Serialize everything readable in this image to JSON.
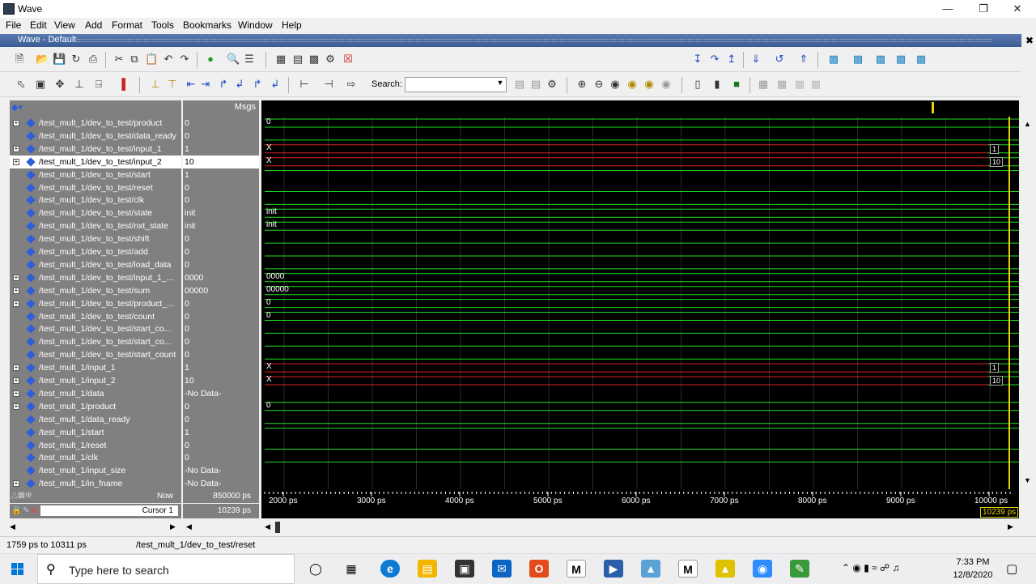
{
  "window": {
    "title": "Wave",
    "subwindow_title": "Wave - Default"
  },
  "menu": [
    "File",
    "Edit",
    "View",
    "Add",
    "Format",
    "Tools",
    "Bookmarks",
    "Window",
    "Help"
  ],
  "search": {
    "label": "Search:",
    "value": ""
  },
  "panes": {
    "msgs_header": "Msgs"
  },
  "signals": [
    {
      "name": "/test_mult_1/dev_to_test/product",
      "value": "0",
      "expandable": true
    },
    {
      "name": "/test_mult_1/dev_to_test/data_ready",
      "value": "0",
      "expandable": false
    },
    {
      "name": "/test_mult_1/dev_to_test/input_1",
      "value": "1",
      "expandable": true
    },
    {
      "name": "/test_mult_1/dev_to_test/input_2",
      "value": "10",
      "expandable": true,
      "selected": true
    },
    {
      "name": "/test_mult_1/dev_to_test/start",
      "value": "1",
      "expandable": false
    },
    {
      "name": "/test_mult_1/dev_to_test/reset",
      "value": "0",
      "expandable": false
    },
    {
      "name": "/test_mult_1/dev_to_test/clk",
      "value": "0",
      "expandable": false
    },
    {
      "name": "/test_mult_1/dev_to_test/state",
      "value": "init",
      "expandable": false
    },
    {
      "name": "/test_mult_1/dev_to_test/nxt_state",
      "value": "init",
      "expandable": false
    },
    {
      "name": "/test_mult_1/dev_to_test/shift",
      "value": "0",
      "expandable": false
    },
    {
      "name": "/test_mult_1/dev_to_test/add",
      "value": "0",
      "expandable": false
    },
    {
      "name": "/test_mult_1/dev_to_test/load_data",
      "value": "0",
      "expandable": false
    },
    {
      "name": "/test_mult_1/dev_to_test/input_1_...",
      "value": "0000",
      "expandable": true
    },
    {
      "name": "/test_mult_1/dev_to_test/sum",
      "value": "00000",
      "expandable": true
    },
    {
      "name": "/test_mult_1/dev_to_test/product_...",
      "value": "0",
      "expandable": true
    },
    {
      "name": "/test_mult_1/dev_to_test/count",
      "value": "0",
      "expandable": false
    },
    {
      "name": "/test_mult_1/dev_to_test/start_co...",
      "value": "0",
      "expandable": false
    },
    {
      "name": "/test_mult_1/dev_to_test/start_co...",
      "value": "0",
      "expandable": false
    },
    {
      "name": "/test_mult_1/dev_to_test/start_count",
      "value": "0",
      "expandable": false
    },
    {
      "name": "/test_mult_1/input_1",
      "value": "1",
      "expandable": true
    },
    {
      "name": "/test_mult_1/input_2",
      "value": "10",
      "expandable": true
    },
    {
      "name": "/test_mult_1/data",
      "value": "-No Data-",
      "expandable": true
    },
    {
      "name": "/test_mult_1/product",
      "value": "0",
      "expandable": true
    },
    {
      "name": "/test_mult_1/data_ready",
      "value": "0",
      "expandable": false
    },
    {
      "name": "/test_mult_1/start",
      "value": "1",
      "expandable": false
    },
    {
      "name": "/test_mult_1/reset",
      "value": "0",
      "expandable": false
    },
    {
      "name": "/test_mult_1/clk",
      "value": "0",
      "expandable": false
    },
    {
      "name": "/test_mult_1/input_size",
      "value": "-No Data-",
      "expandable": false
    },
    {
      "name": "/test_mult_1/in_fname",
      "value": "-No Data-",
      "expandable": true
    }
  ],
  "waves": [
    {
      "type": "bus",
      "color": "#22dd22",
      "start_text": "0"
    },
    {
      "type": "low",
      "color": "#22dd22"
    },
    {
      "type": "bus",
      "color": "#dd2222",
      "start_text": "X",
      "end_text": "1"
    },
    {
      "type": "bus",
      "color": "#dd2222",
      "start_text": "X",
      "end_text": "10"
    },
    {
      "type": "high",
      "color": "#22dd22"
    },
    {
      "type": "low",
      "color": "#22dd22"
    },
    {
      "type": "low",
      "color": "#22dd22"
    },
    {
      "type": "bus",
      "color": "#22dd22",
      "start_text": "init"
    },
    {
      "type": "bus",
      "color": "#22dd22",
      "start_text": "init"
    },
    {
      "type": "low",
      "color": "#22dd22"
    },
    {
      "type": "low",
      "color": "#22dd22"
    },
    {
      "type": "low",
      "color": "#22dd22"
    },
    {
      "type": "bus",
      "color": "#22dd22",
      "start_text": "0000"
    },
    {
      "type": "bus",
      "color": "#22dd22",
      "start_text": "00000"
    },
    {
      "type": "bus",
      "color": "#22dd22",
      "start_text": "0"
    },
    {
      "type": "bus",
      "color": "#22dd22",
      "start_text": "0"
    },
    {
      "type": "low",
      "color": "#22dd22"
    },
    {
      "type": "low",
      "color": "#22dd22"
    },
    {
      "type": "low",
      "color": "#22dd22"
    },
    {
      "type": "bus",
      "color": "#dd2222",
      "start_text": "X",
      "end_text": "1"
    },
    {
      "type": "bus",
      "color": "#dd2222",
      "start_text": "X",
      "end_text": "10"
    },
    {
      "type": "none",
      "color": "#22dd22"
    },
    {
      "type": "bus",
      "color": "#22dd22",
      "start_text": "0"
    },
    {
      "type": "low",
      "color": "#22dd22"
    },
    {
      "type": "high",
      "color": "#22dd22"
    },
    {
      "type": "low",
      "color": "#22dd22"
    },
    {
      "type": "low",
      "color": "#22dd22"
    },
    {
      "type": "none",
      "color": "#22dd22"
    },
    {
      "type": "none",
      "color": "#22dd22"
    }
  ],
  "time": {
    "now_label": "Now",
    "now_value": "850000 ps",
    "cursor_label": "Cursor 1",
    "cursor_value": "10239 ps",
    "cursor_marker": "10239 ps",
    "ticks": [
      "2000 ps",
      "3000 ps",
      "4000 ps",
      "5000 ps",
      "6000 ps",
      "7000 ps",
      "8000 ps",
      "9000 ps",
      "10000 ps"
    ]
  },
  "status": {
    "range": "1759 ps to 10311 ps",
    "selected_path": "/test_mult_1/dev_to_test/reset"
  },
  "taskbar": {
    "search_placeholder": "Type here to search",
    "time": "7:33 PM",
    "date": "12/8/2020"
  },
  "colors": {
    "accent": "#3b5b94",
    "cursor": "#e6d300",
    "wave_green": "#22dd22",
    "wave_red": "#dd2222"
  }
}
